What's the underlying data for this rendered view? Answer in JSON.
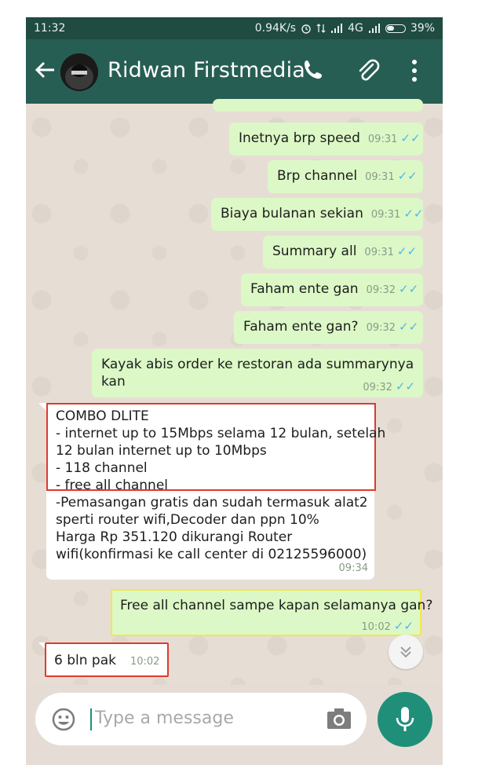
{
  "status": {
    "time": "11:32",
    "speed": "0.94K/s",
    "network": "4G",
    "battery": "39%"
  },
  "header": {
    "contact": "Ridwan Firstmedia"
  },
  "messages": [
    {
      "text": "Inetnya brp speed",
      "time": "09:31"
    },
    {
      "text": "Brp channel",
      "time": "09:31"
    },
    {
      "text": "Biaya bulanan sekian",
      "time": "09:31"
    },
    {
      "text": "Summary all",
      "time": "09:31"
    },
    {
      "text": "Faham ente gan",
      "time": "09:32"
    },
    {
      "text": "Faham ente gan?",
      "time": "09:32"
    },
    {
      "line1": "Kayak abis order ke restoran ada summarynya",
      "line2": "kan",
      "time": "09:32"
    }
  ],
  "incoming": {
    "lines": [
      "COMBO DLITE",
      "- internet up to 15Mbps selama 12 bulan, setelah",
      "12 bulan internet up to 10Mbps",
      "- 118 channel",
      "- free all channel",
      "-Pemasangan gratis dan sudah termasuk alat2",
      "sperti router wifi,Decoder dan ppn 10%",
      "Harga Rp 351.120 dikurangi Router",
      "wifi(konfirmasi ke call center di 02125596000)"
    ],
    "time": "09:34"
  },
  "question": {
    "text": "Free all channel sampe kapan selamanya gan?",
    "time": "10:02"
  },
  "reply": {
    "text": "6 bln pak",
    "time": "10:02"
  },
  "input": {
    "placeholder": "Type a message"
  },
  "ticks": "✓✓"
}
